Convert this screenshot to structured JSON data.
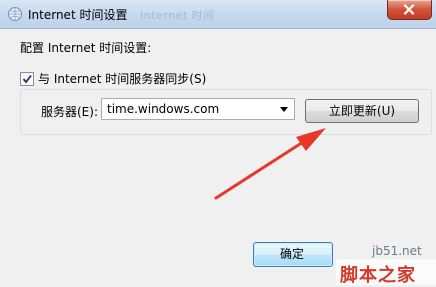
{
  "window": {
    "title": "Internet 时间设置",
    "background_title": "Internet 时间"
  },
  "main": {
    "heading": "配置 Internet 时间设置:",
    "sync_checkbox": {
      "label": "与 Internet 时间服务器同步(S)",
      "checked": true
    },
    "server_label": "服务器(E):",
    "server_value": "time.windows.com",
    "update_button": "立即更新(U)"
  },
  "footer": {
    "ok_button": "确定"
  },
  "watermark": {
    "site": "jb51.net",
    "logo_text": "脚本之家"
  },
  "colors": {
    "arrow": "#e8372a",
    "close_button": "#c9472f",
    "title_bar": "#c9dbef"
  }
}
